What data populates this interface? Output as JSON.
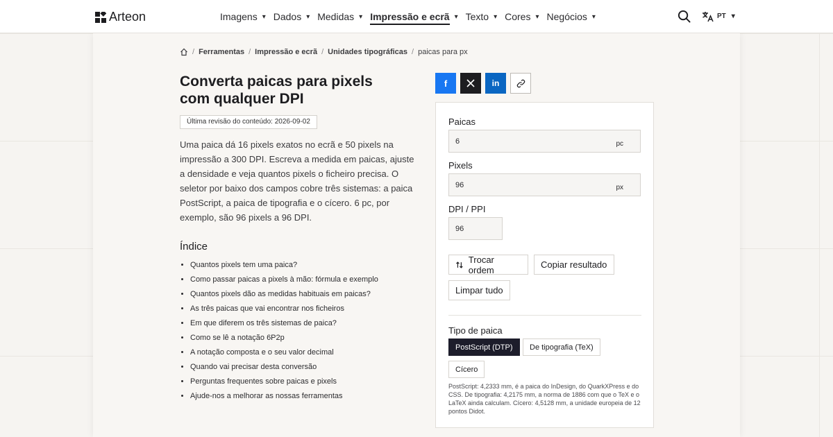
{
  "header": {
    "brand": "Arteon",
    "nav": [
      {
        "label": "Imagens",
        "active": false
      },
      {
        "label": "Dados",
        "active": false
      },
      {
        "label": "Medidas",
        "active": false
      },
      {
        "label": "Impressão e ecrã",
        "active": true
      },
      {
        "label": "Texto",
        "active": false
      },
      {
        "label": "Cores",
        "active": false
      },
      {
        "label": "Negócios",
        "active": false
      }
    ],
    "lang": "PT",
    "icons": {
      "search": "search-icon",
      "translate": "translate-icon",
      "caret": "▾"
    }
  },
  "breadcrumb": {
    "home_icon": "home-icon",
    "items": [
      "Ferramentas",
      "Impressão e ecrã",
      "Unidades tipográficas",
      "paicas para px"
    ]
  },
  "main": {
    "title": "Converta paicas para pixels com qualquer DPI",
    "revision": "Última revisão do conteúdo: 2026-09-02",
    "intro": "Uma paica dá 16 pixels exatos no ecrã e 50 pixels na impressão a 300 DPI. Escreva a medida em paicas, ajuste a densidade e veja quantos pixels o ficheiro precisa. O seletor por baixo dos campos cobre três sistemas: a paica PostScript, a paica de tipografia e o cícero. 6 pc, por exemplo, são 96 pixels a 96 DPI.",
    "toc_title": "Índice",
    "toc": [
      "Quantos pixels tem uma paica?",
      "Como passar paicas a pixels à mão: fórmula e exemplo",
      "Quantos pixels dão as medidas habituais em paicas?",
      "As três paicas que vai encontrar nos ficheiros",
      "Em que diferem os três sistemas de paica?",
      "Como se lê a notação 6P2p",
      "A notação composta e o seu valor decimal",
      "Quando vai precisar desta conversão",
      "Perguntas frequentes sobre paicas e pixels",
      "Ajude-nos a melhorar as nossas ferramentas"
    ]
  },
  "share": {
    "facebook": "f",
    "x": "X",
    "linkedin": "in",
    "icons": [
      "facebook-icon",
      "x-icon",
      "linkedin-icon",
      "link-icon"
    ],
    "colors": {
      "facebook": "#1877f2",
      "x": "#1d1d20",
      "linkedin": "#0a66c2"
    }
  },
  "converter": {
    "picas_label": "Paicas",
    "picas_value": "6",
    "picas_unit": "pc",
    "pixels_label": "Pixels",
    "pixels_value": "96",
    "pixels_unit": "px",
    "dpi_label": "DPI / PPI",
    "dpi_value": "96",
    "swap_label": "Trocar ordem",
    "copy_label": "Copiar resultado",
    "clear_label": "Limpar tudo",
    "type_label": "Tipo de paica",
    "types": [
      "PostScript (DTP)",
      "De tipografia (TeX)",
      "Cícero"
    ],
    "selected_type": "PostScript (DTP)",
    "note": "PostScript: 4,2333 mm, é a paica do InDesign, do QuarkXPress e do CSS. De tipografia: 4,2175 mm, a norma de 1886 com que o TeX e o LaTeX ainda calculam. Cícero: 4,5128 mm, a unidade europeia de 12 pontos Didot."
  }
}
